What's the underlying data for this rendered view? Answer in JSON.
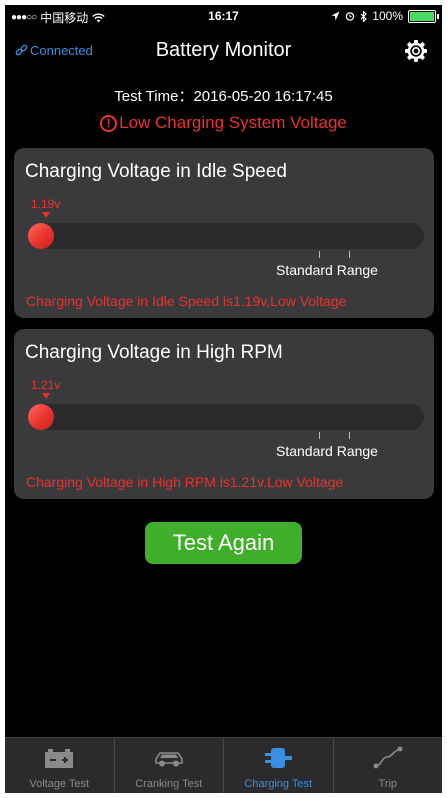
{
  "status_bar": {
    "carrier": "中国移动",
    "time": "16:17",
    "battery_percent": "100%",
    "battery_level": 1.0
  },
  "nav": {
    "connection": "Connected",
    "title": "Battery Monitor"
  },
  "test_time": "Test Time：2016-05-20 16:17:45",
  "warning": "Low Charging System Voltage",
  "cards": [
    {
      "title": "Charging Voltage in Idle Speed",
      "value": "1.19v",
      "standard_range": "Standard Range",
      "message": "Charging Voltage in Idle Speed is1.19v,Low Voltage"
    },
    {
      "title": "Charging Voltage in High RPM",
      "value": "1.21v",
      "standard_range": "Standard Range",
      "message": "Charging Voltage in High RPM is1.21v,Low Voltage"
    }
  ],
  "test_again": "Test Again",
  "tabs": [
    {
      "label": "Voltage Test",
      "icon": "battery-icon"
    },
    {
      "label": "Cranking Test",
      "icon": "car-icon"
    },
    {
      "label": "Charging Test",
      "icon": "charging-plug-icon",
      "active": true
    },
    {
      "label": "Trip",
      "icon": "trip-route-icon"
    }
  ],
  "colors": {
    "accent_blue": "#3a8fe0",
    "alert_red": "#e8332d",
    "button_green": "#3fae2a",
    "card_bg": "#3a3a3c"
  }
}
